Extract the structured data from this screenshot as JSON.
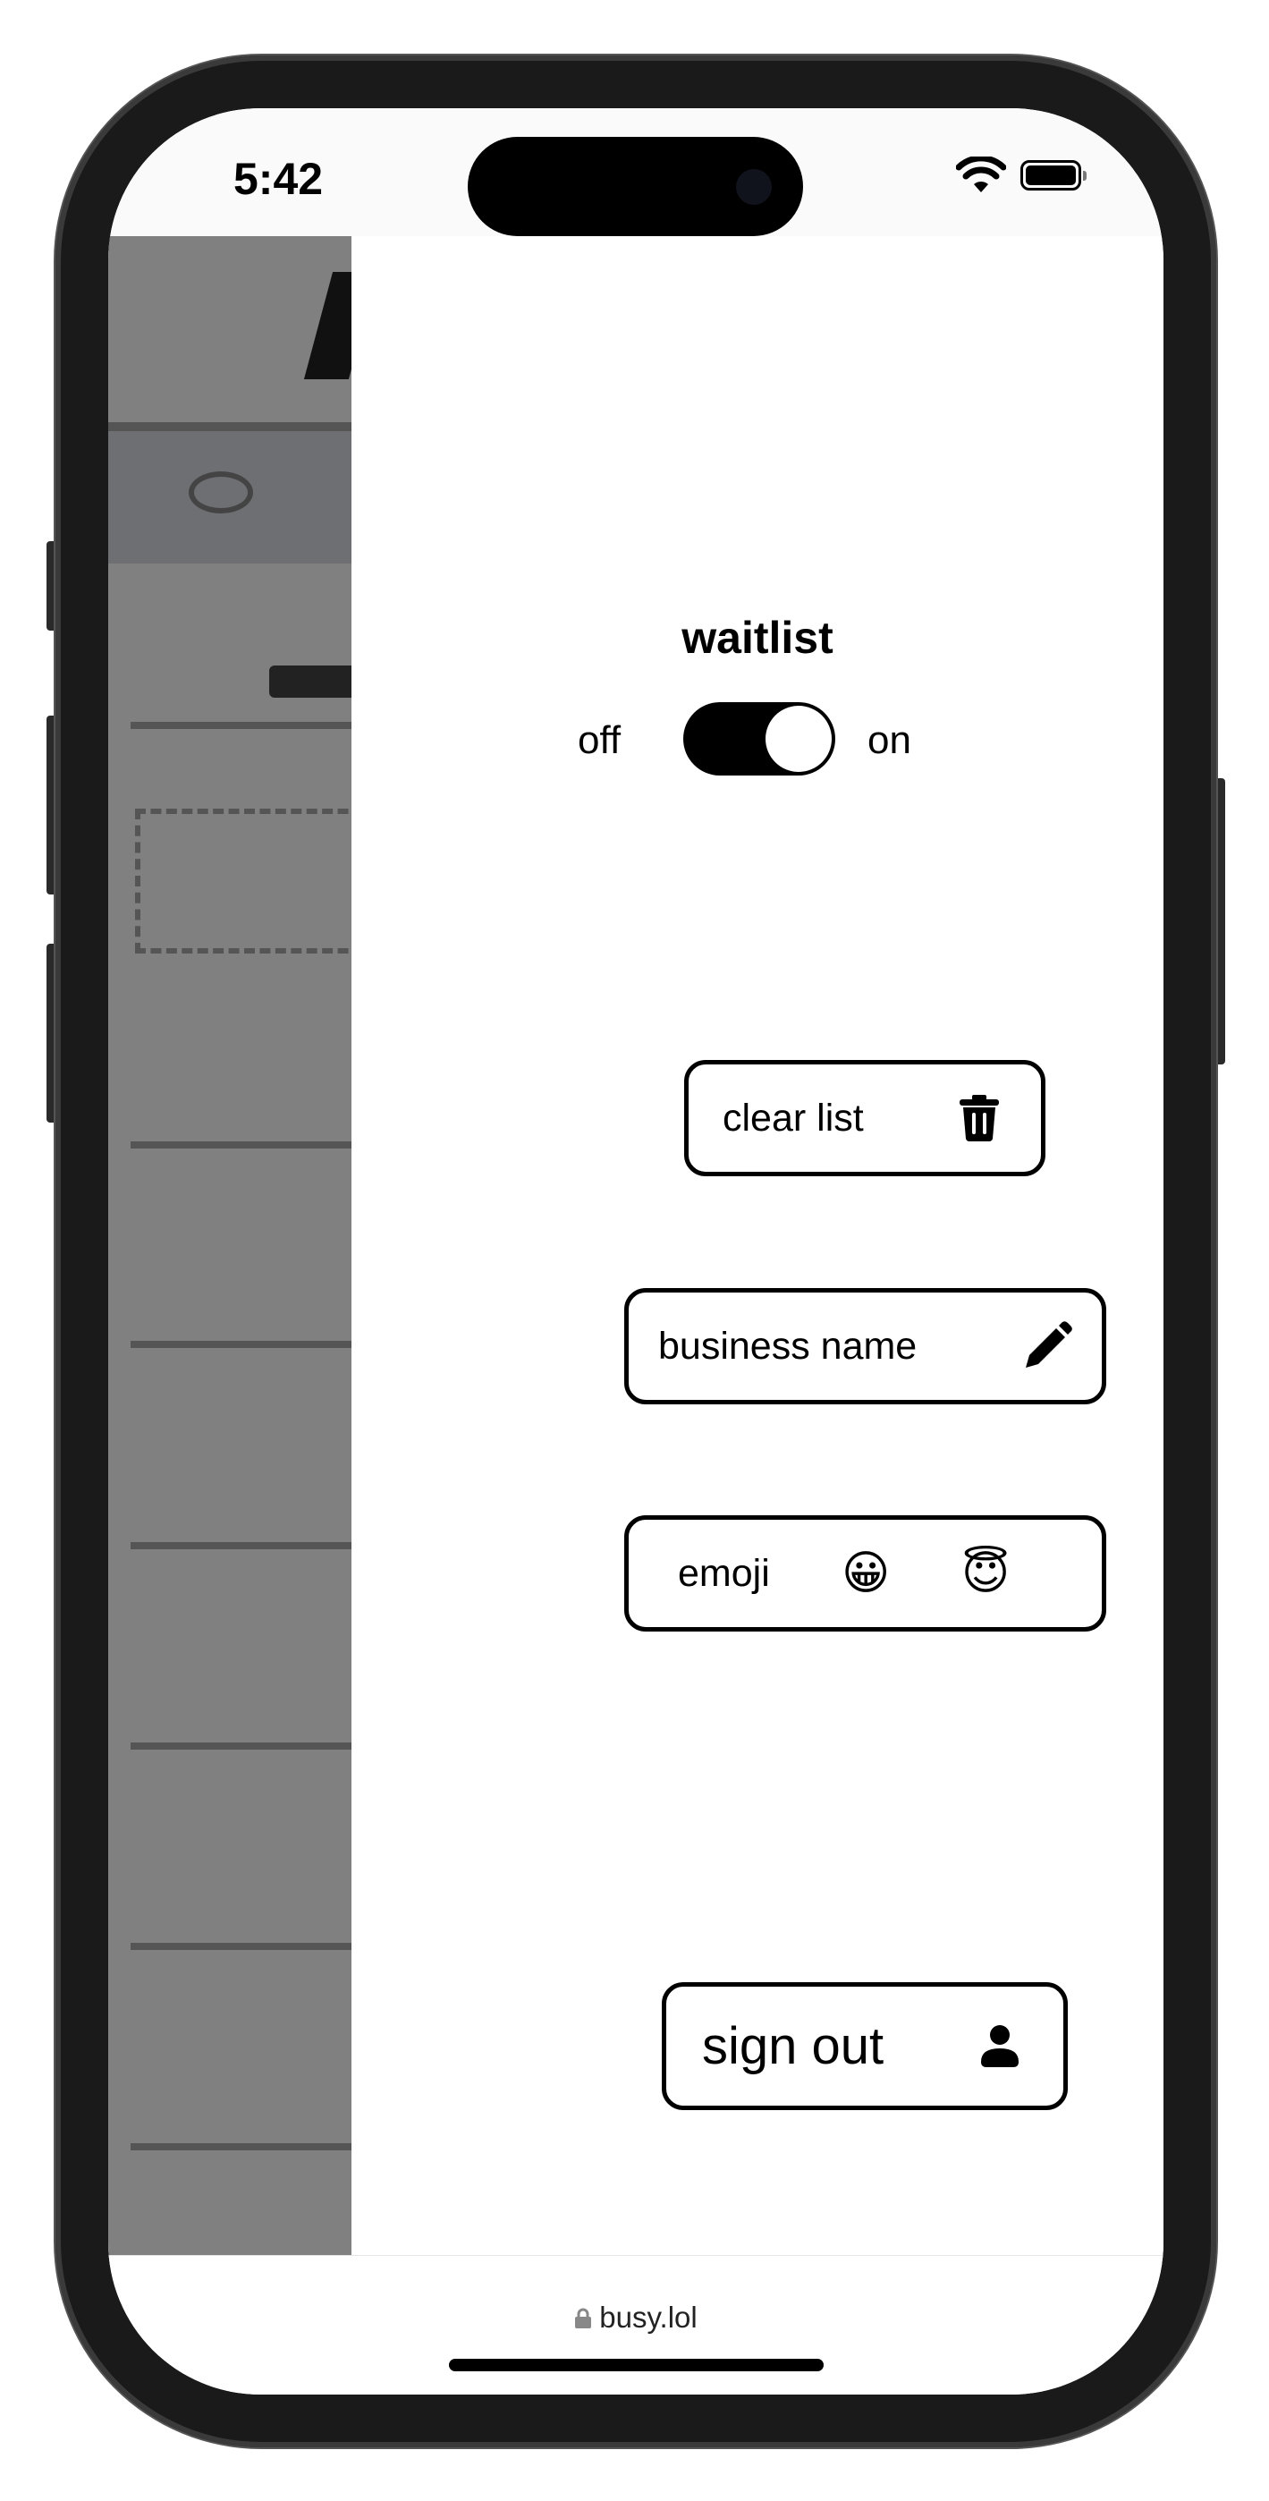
{
  "status_bar": {
    "time": "5:42",
    "wifi_icon": "wifi-icon",
    "battery_icon": "battery-icon"
  },
  "drawer": {
    "waitlist": {
      "title": "waitlist",
      "off_label": "off",
      "on_label": "on",
      "enabled": true
    },
    "clear_list": {
      "label": "clear list",
      "icon": "trash-icon"
    },
    "business_name": {
      "label": "business name",
      "icon": "pencil-icon"
    },
    "emoji": {
      "label": "emoji",
      "options": [
        "😀",
        "😇"
      ]
    },
    "sign_out": {
      "label": "sign out",
      "icon": "user-icon"
    }
  },
  "browser": {
    "url": "busy.lol",
    "lock_icon": "lock-icon"
  }
}
